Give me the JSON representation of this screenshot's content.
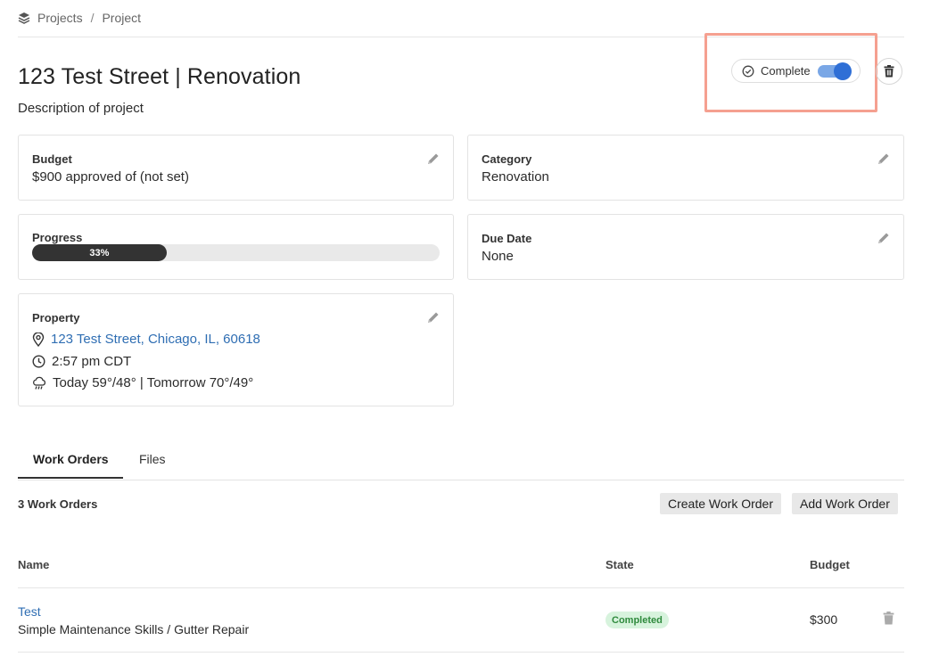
{
  "breadcrumb": {
    "icon": "layers-icon",
    "items": [
      "Projects",
      "Project"
    ],
    "separator": "/"
  },
  "project": {
    "title": "123 Test Street | Renovation",
    "description": "Description of project"
  },
  "status_toggle": {
    "label": "Complete",
    "on": true,
    "icon": "check-circle-icon"
  },
  "cards": {
    "budget": {
      "title": "Budget",
      "value": "$900 approved of (not set)"
    },
    "category": {
      "title": "Category",
      "value": "Renovation"
    },
    "progress": {
      "title": "Progress",
      "percent": 33,
      "label": "33%"
    },
    "due_date": {
      "title": "Due Date",
      "value": "None"
    },
    "property": {
      "title": "Property",
      "address": "123 Test Street, Chicago, IL, 60618",
      "time": "2:57 pm CDT",
      "weather": "Today 59°/48° | Tomorrow 70°/49°"
    }
  },
  "tabs": [
    {
      "label": "Work Orders",
      "active": true
    },
    {
      "label": "Files",
      "active": false
    }
  ],
  "work_orders": {
    "count_label": "3 Work Orders",
    "create_button": "Create Work Order",
    "add_button": "Add Work Order",
    "columns": [
      "Name",
      "State",
      "Budget"
    ],
    "rows": [
      {
        "name": "Test",
        "subtitle": "Simple Maintenance Skills / Gutter Repair",
        "state": "Completed",
        "budget": "$300"
      }
    ]
  },
  "colors": {
    "accent": "#2f6fd6",
    "link": "#2f6eb3",
    "highlight": "#f5a090",
    "badge_bg": "#d7f3dd",
    "badge_text": "#2f8a3d"
  }
}
